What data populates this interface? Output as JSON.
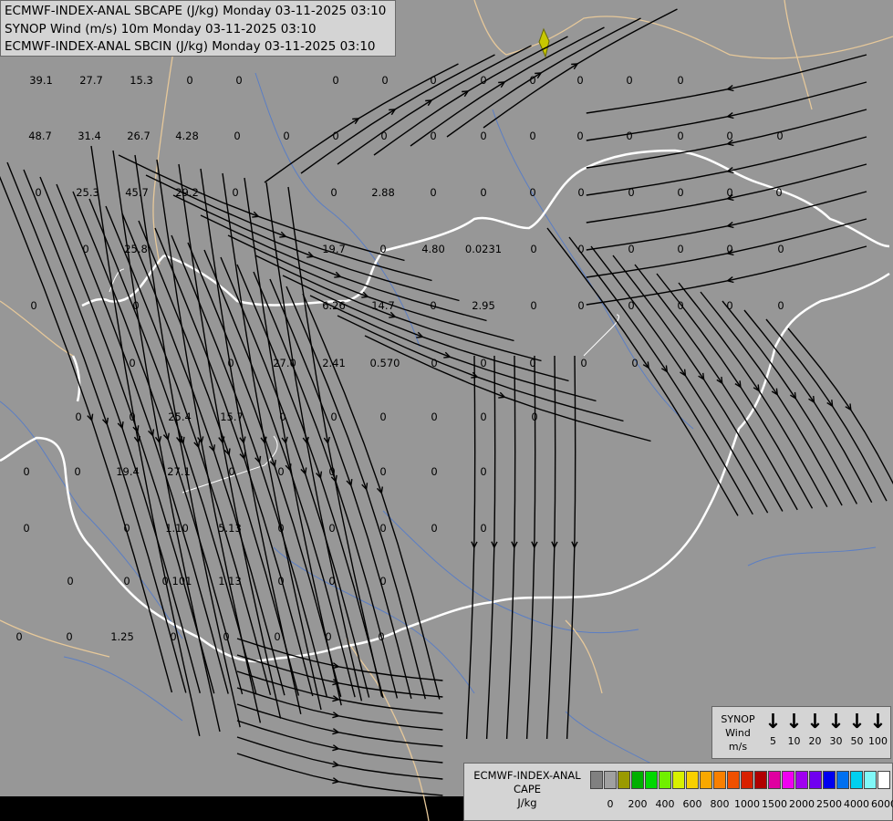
{
  "header": {
    "line1": "ECMWF-INDEX-ANAL SBCAPE (J/kg) Monday 03-11-2025 03:10",
    "line2": "SYNOP Wind (m/s) 10m Monday 03-11-2025 03:10",
    "line3": "ECMWF-INDEX-ANAL SBCIN (J/kg) Monday 03-11-2025 03:10"
  },
  "colors": {
    "background": "#979797",
    "streamline": "#000000",
    "border_national": "#ffffff",
    "border_other": "#e6c89a",
    "river": "#5b7ec4",
    "marker": "#c8c800"
  },
  "values": [
    "39.1",
    "27.7",
    "15.3",
    "0",
    "0",
    "0",
    "0",
    "0",
    "0",
    "0",
    "0",
    "0",
    "0",
    "48.7",
    "31.4",
    "26.7",
    "4.28",
    "0",
    "0",
    "0",
    "0",
    "0",
    "0",
    "0",
    "0",
    "0",
    "0",
    "0",
    "0",
    "0",
    "25.3",
    "45.7",
    "29.2",
    "0",
    "0",
    "2.88",
    "0",
    "0",
    "0",
    "0",
    "0",
    "0",
    "0",
    "0",
    "0",
    "25.8",
    "19.7",
    "0",
    "4.80",
    "0.0231",
    "0",
    "0",
    "0",
    "0",
    "0",
    "0",
    "0",
    "0",
    "6.26",
    "14.7",
    "0",
    "2.95",
    "0",
    "0",
    "0",
    "0",
    "0",
    "0",
    "0",
    "0",
    "27.0",
    "2.41",
    "0.570",
    "0",
    "0",
    "0",
    "0",
    "0",
    "0",
    "0",
    "25.4",
    "15.7",
    "0",
    "0",
    "0",
    "0",
    "0",
    "0",
    "0",
    "0",
    "19.4",
    "27.1",
    "0",
    "0",
    "0",
    "0",
    "0",
    "0",
    "0",
    "0",
    "1.10",
    "5.13",
    "0",
    "0",
    "0",
    "0",
    "0",
    "0",
    "0",
    "0.101",
    "1.13",
    "0",
    "0",
    "0",
    "0",
    "0",
    "1.25",
    "0",
    "0",
    "0",
    "0",
    "0",
    "0",
    "0"
  ],
  "wind_legend": {
    "label_line1": "SYNOP",
    "label_line2": "Wind",
    "label_line3": "m/s",
    "speeds": [
      "5",
      "10",
      "20",
      "30",
      "50",
      "100"
    ]
  },
  "cape_legend": {
    "label_line1": "ECMWF-INDEX-ANAL",
    "label_line2": "CAPE",
    "label_line3": "J/kg",
    "colors": [
      "#808080",
      "#a0a0a0",
      "#9a9a00",
      "#00b000",
      "#00d800",
      "#70f000",
      "#d8f000",
      "#f8d000",
      "#f8a800",
      "#f88000",
      "#f05000",
      "#d82000",
      "#b00000",
      "#e000a0",
      "#f000f0",
      "#a000f0",
      "#7000f0",
      "#0000f0",
      "#0070f0",
      "#00d0f0",
      "#80f8f8",
      "#ffffff"
    ],
    "ticks": [
      "0",
      "200",
      "400",
      "600",
      "800",
      "1000",
      "1500",
      "2000",
      "2500",
      "4000",
      "6000"
    ]
  }
}
